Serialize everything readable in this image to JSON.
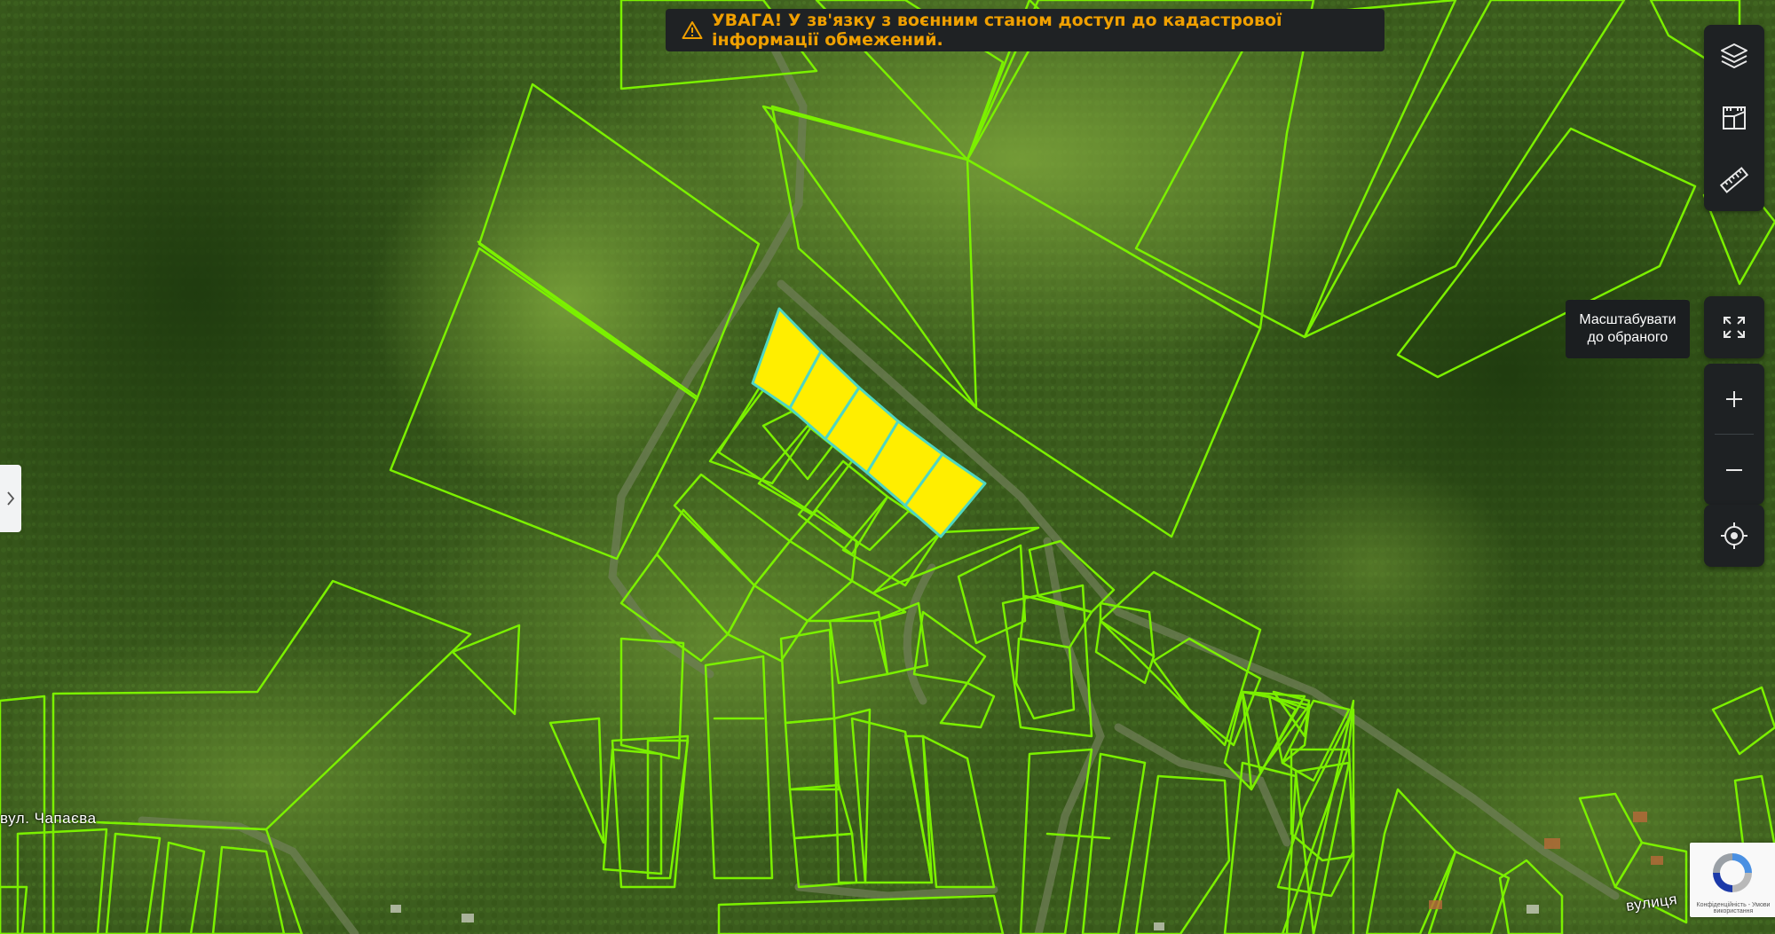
{
  "warning": {
    "text": "УВАГА! У зв'язку з воєнним станом доступ до кадастрової інформації обмежений.",
    "color": "#f0a000",
    "icon": "warning-triangle-icon"
  },
  "toolbar": {
    "buttons": [
      {
        "name": "layers-button",
        "icon": "layers-icon"
      },
      {
        "name": "cadastre-info-button",
        "icon": "cadastre-map-icon"
      },
      {
        "name": "measure-button",
        "icon": "ruler-icon"
      }
    ]
  },
  "fit_button": {
    "icon": "fit-to-selection-icon",
    "tooltip": "Масштабувати\nдо обраного"
  },
  "zoom": {
    "in_icon": "plus-icon",
    "out_icon": "minus-icon"
  },
  "locate_button": {
    "icon": "locate-crosshair-icon"
  },
  "side_panel_toggle": {
    "icon": "chevron-right-icon"
  },
  "streets": [
    {
      "label": "вул. Чапаєва"
    },
    {
      "label": "вулиця"
    }
  ],
  "recaptcha": {
    "privacy_text": "Конфіденційність - Умови використання"
  },
  "colors": {
    "parcel_outline": "#7bf000",
    "selected_fill": "#ffee00",
    "selected_outline": "#4fd6c2",
    "ui_dark": "#1e2123"
  }
}
